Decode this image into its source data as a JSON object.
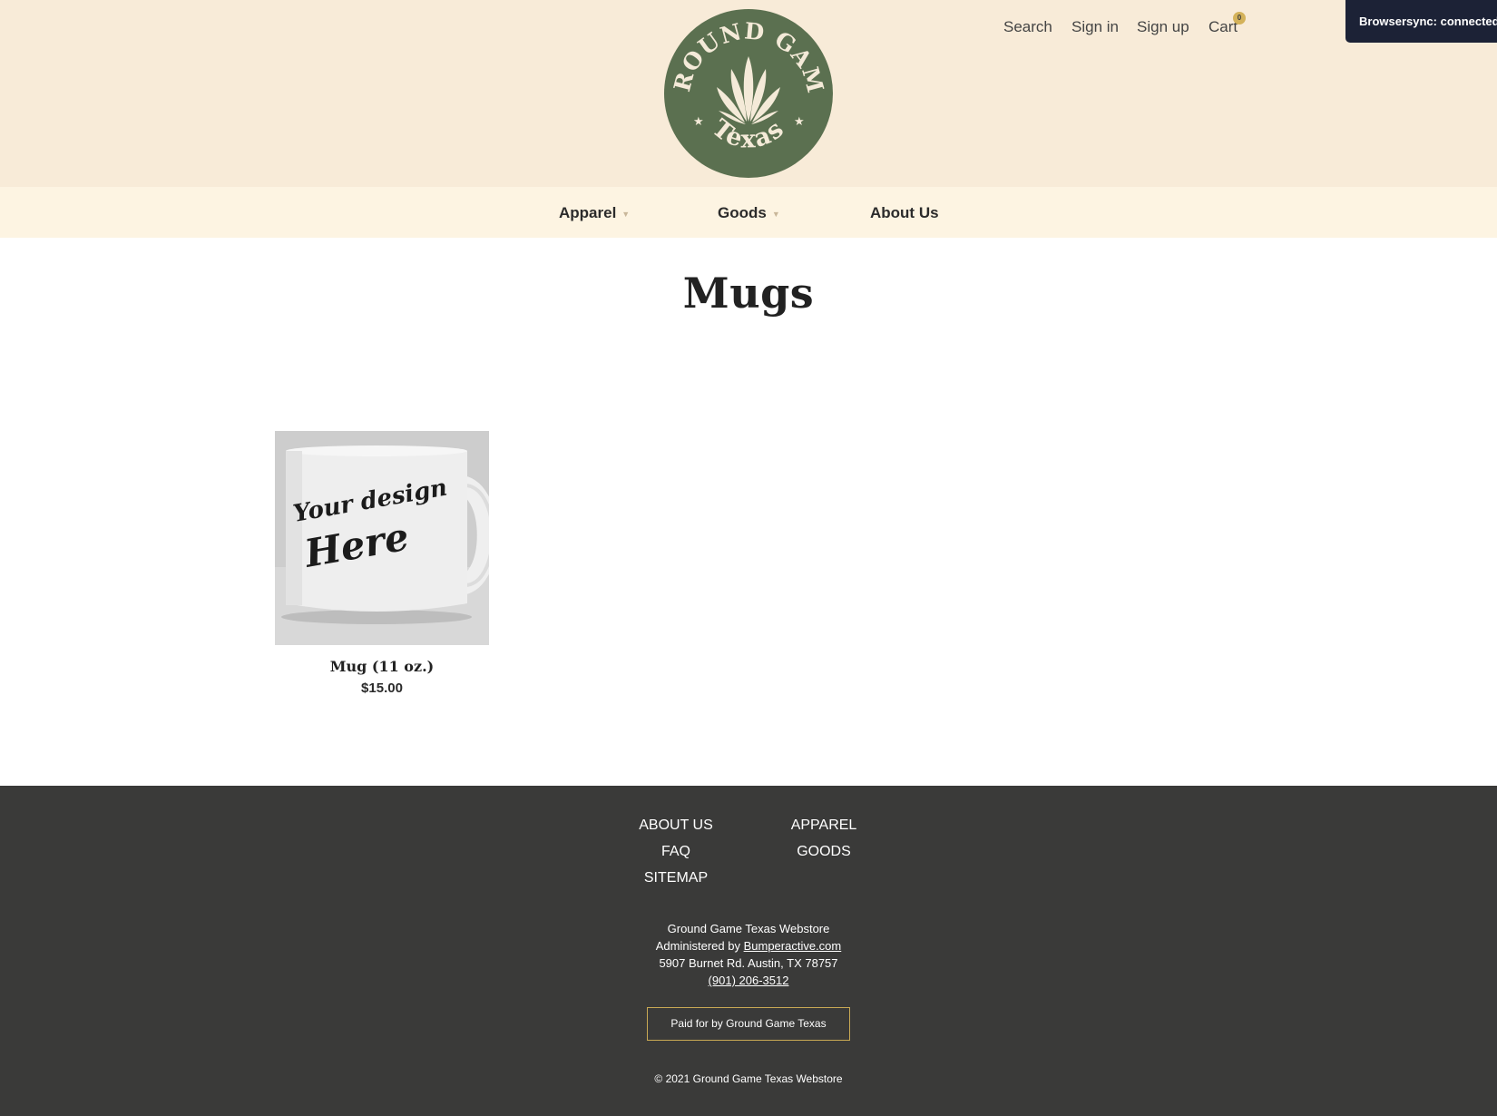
{
  "header": {
    "logo_alt": "Ground Game Texas",
    "logo_text_top": "GROUND GAME",
    "logo_text_bottom": "Texas",
    "utility_nav": {
      "search": "Search",
      "sign_in": "Sign in",
      "sign_up": "Sign up",
      "cart": "Cart",
      "cart_count": "0"
    }
  },
  "browsersync": {
    "message": "Browsersync: connected"
  },
  "main_nav": {
    "items": [
      {
        "label": "Apparel",
        "has_dropdown": true
      },
      {
        "label": "Goods",
        "has_dropdown": true
      },
      {
        "label": "About Us",
        "has_dropdown": false
      }
    ]
  },
  "page": {
    "title": "Mugs"
  },
  "products": [
    {
      "name": "Mug (11 oz.)",
      "price": "$15.00",
      "image_text_line1": "Your design",
      "image_text_line2": "Here"
    }
  ],
  "footer": {
    "col1": [
      "ABOUT US",
      "FAQ",
      "SITEMAP"
    ],
    "col2": [
      "APPAREL",
      "GOODS"
    ],
    "store_name": "Ground Game Texas Webstore",
    "administered_prefix": "Administered by",
    "administered_link": "Bumperactive.com",
    "address": "5907 Burnet Rd. Austin, TX 78757",
    "phone": "(901) 206-3512",
    "paid_for": "Paid for by Ground Game Texas",
    "copyright": "© 2021 Ground Game Texas Webstore"
  },
  "colors": {
    "header_bg": "#f8ebd8",
    "nav_bg": "#fdf4e2",
    "logo_green": "#5b7050",
    "logo_cream": "#f4ead8",
    "footer_bg": "#3a3a39",
    "accent_gold": "#c8a954"
  }
}
